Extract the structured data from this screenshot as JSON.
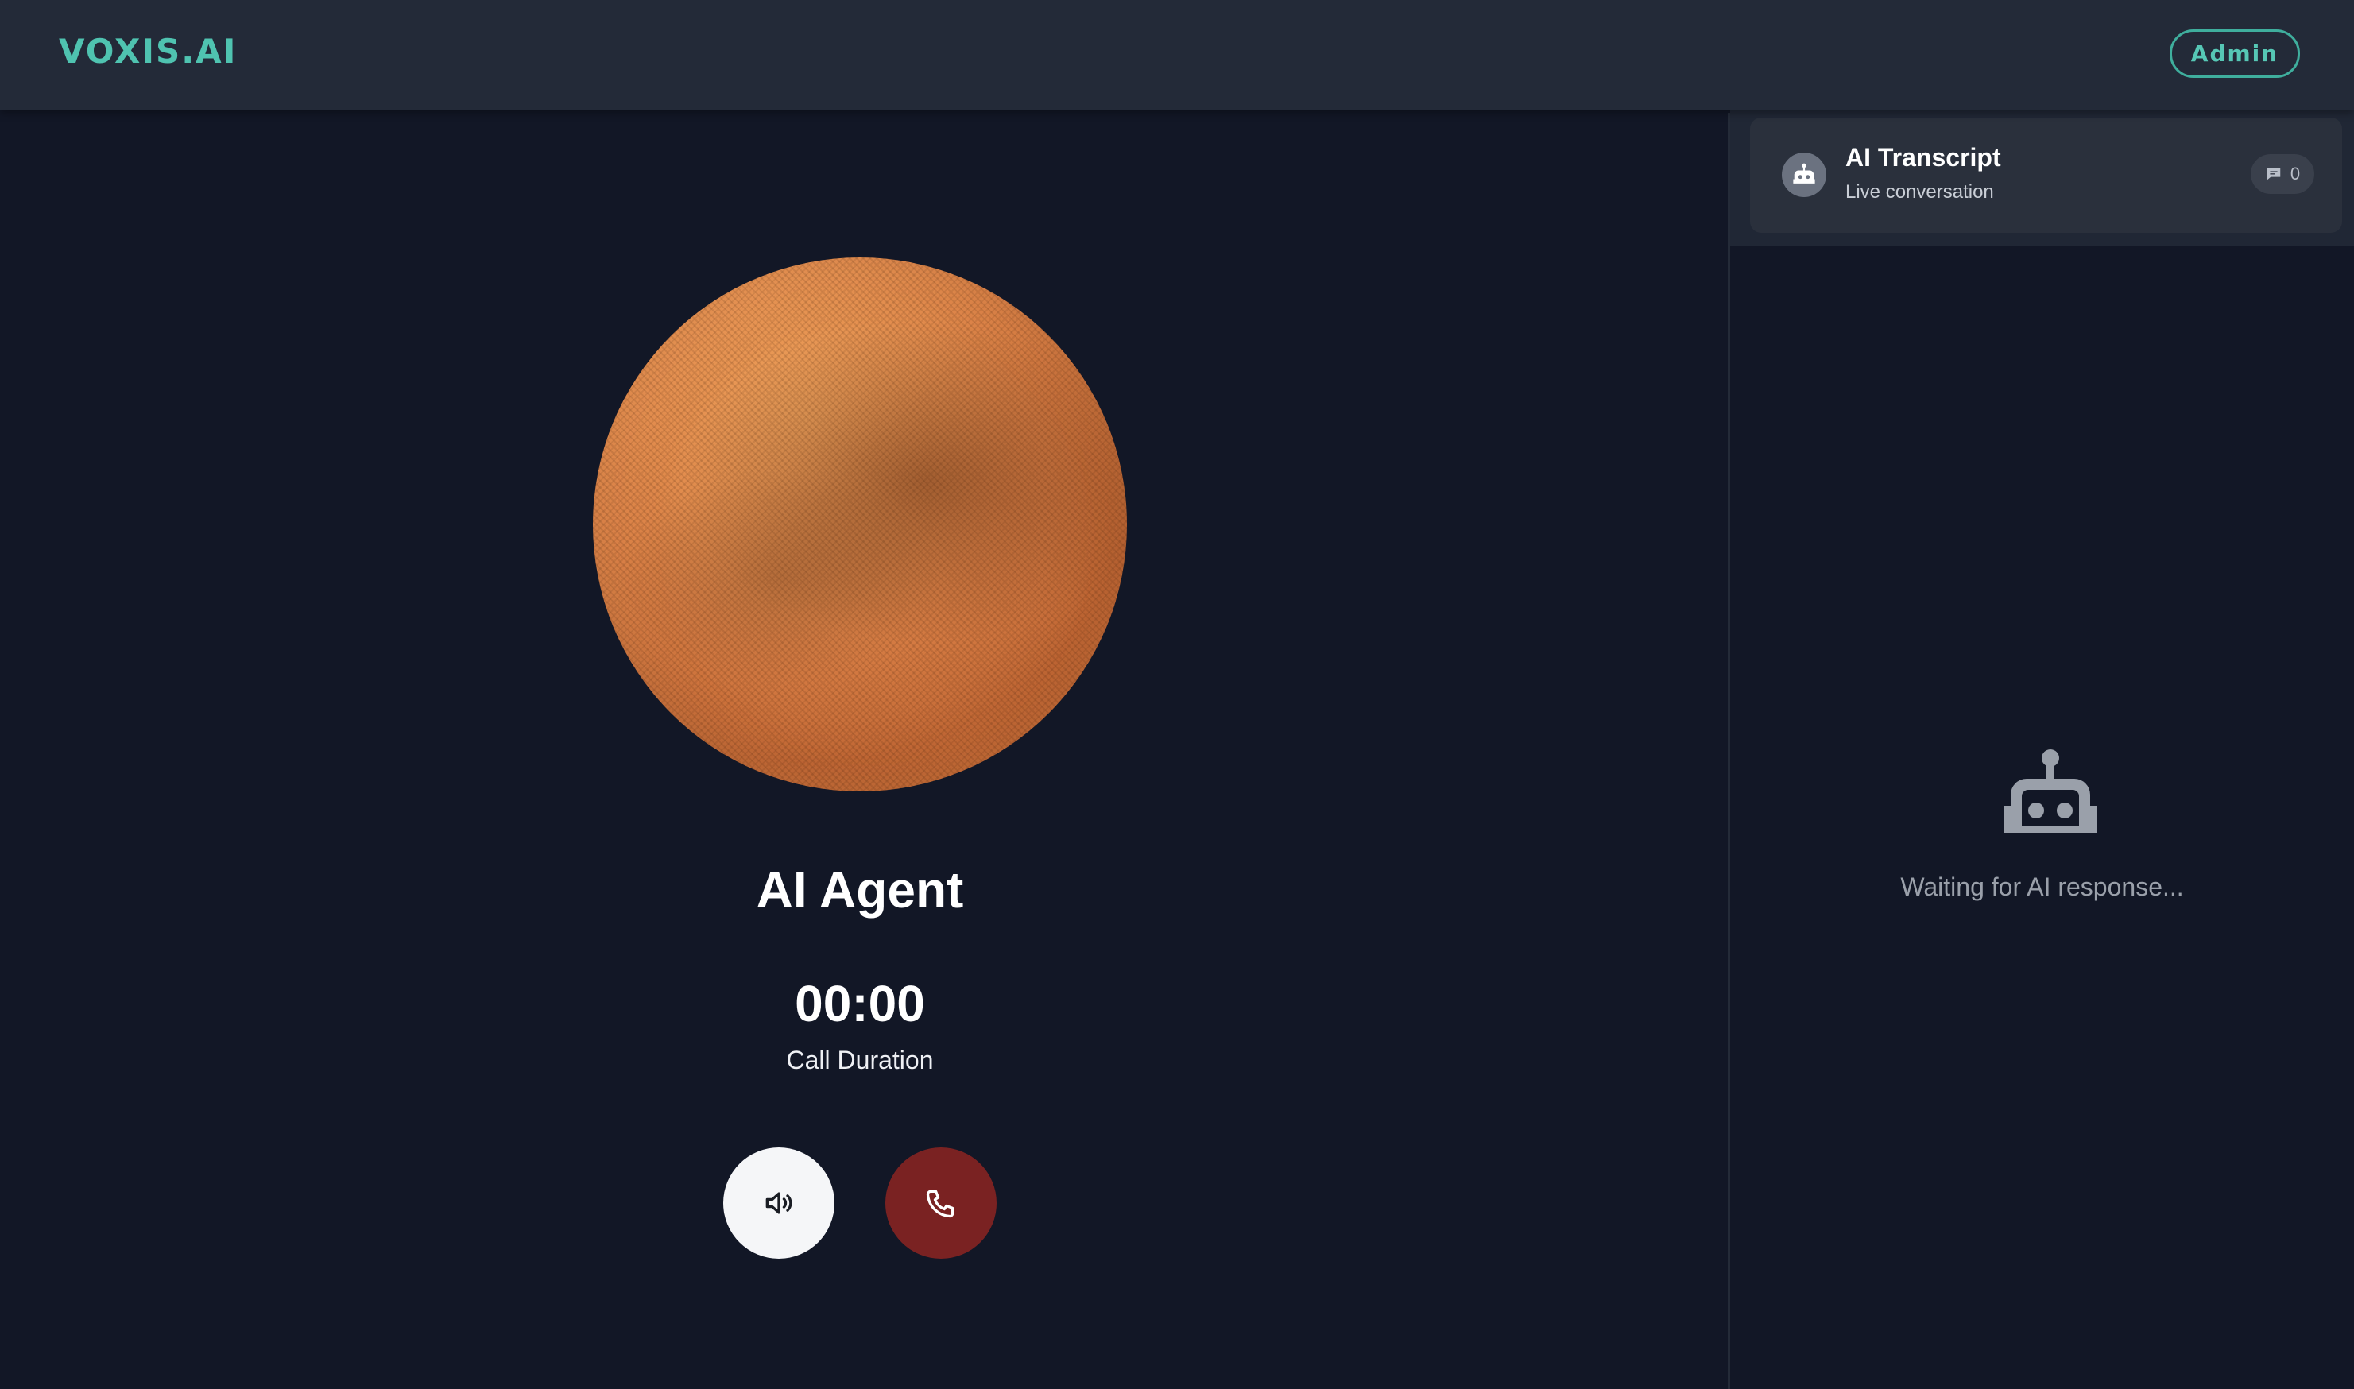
{
  "header": {
    "logo": "VOXIS.AI",
    "admin_label": "Admin"
  },
  "call": {
    "agent_name": "AI Agent",
    "duration": "00:00",
    "duration_label": "Call Duration"
  },
  "controls": [
    {
      "name": "speaker",
      "icon": "speaker-icon"
    },
    {
      "name": "hangup",
      "icon": "phone-icon"
    }
  ],
  "transcript": {
    "title": "AI Transcript",
    "subtitle": "Live conversation",
    "message_count": "0",
    "empty_text": "Waiting for AI response...",
    "avatar_icon": "robot-icon",
    "badge_icon": "chat-icon"
  },
  "colors": {
    "accent": "#4fc3b0",
    "background": "#121726",
    "header": "#232a38",
    "hangup": "#7a2222",
    "orb": "#d97f45"
  }
}
